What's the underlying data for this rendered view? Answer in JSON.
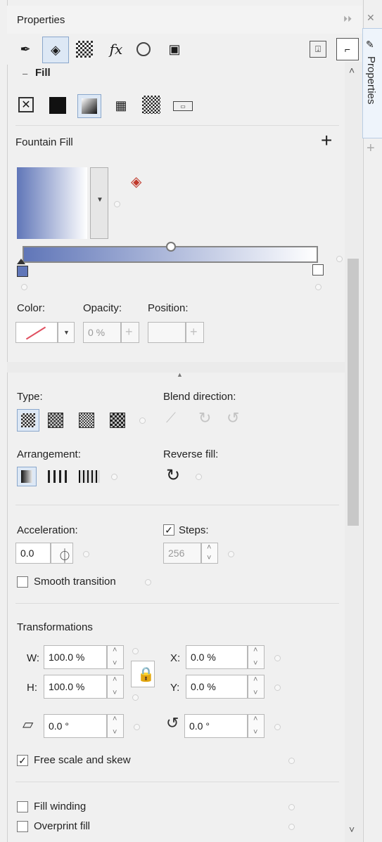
{
  "panel": {
    "title": "Properties",
    "side_tab": "Properties"
  },
  "fill": {
    "section": "Fill",
    "fountain_title": "Fountain Fill"
  },
  "color_row": {
    "color_label": "Color:",
    "opacity_label": "Opacity:",
    "opacity_value": "0 %",
    "position_label": "Position:"
  },
  "type_row": {
    "type_label": "Type:",
    "blend_label": "Blend direction:"
  },
  "arrange_row": {
    "arrangement_label": "Arrangement:",
    "reverse_label": "Reverse fill:"
  },
  "accel": {
    "label": "Acceleration:",
    "value": "0.0",
    "steps_label": "Steps:",
    "steps_value": "256",
    "smooth_label": "Smooth transition"
  },
  "transform": {
    "title": "Transformations",
    "w_label": "W:",
    "w_value": "100.0 %",
    "h_label": "H:",
    "h_value": "100.0 %",
    "x_label": "X:",
    "x_value": "0.0 %",
    "y_label": "Y:",
    "y_value": "0.0 %",
    "skew_value": "0.0 °",
    "rotate_value": "0.0 °",
    "free_scale_label": "Free scale and skew"
  },
  "bottom": {
    "fill_winding": "Fill winding",
    "overprint": "Overprint fill"
  },
  "colors": {
    "accent": "#6076b8",
    "bg": "#f0f0f0"
  }
}
